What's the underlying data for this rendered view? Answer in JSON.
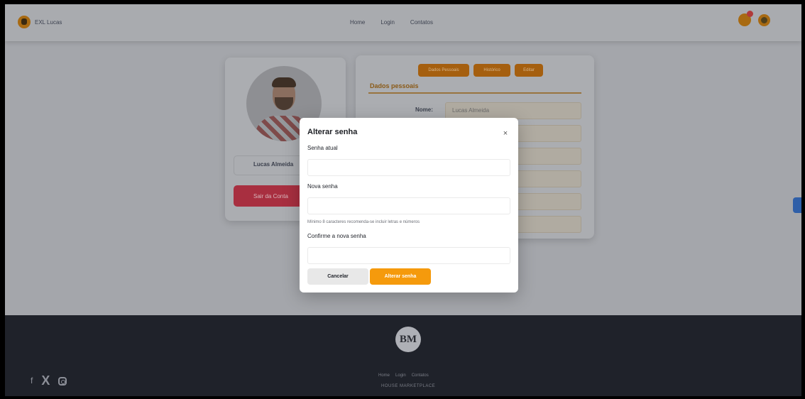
{
  "header": {
    "brand_name": "EXL Lucas",
    "nav": [
      "Home",
      "Login",
      "Contatos"
    ]
  },
  "profile": {
    "name": "Lucas Almeida",
    "exit_label": "Sair da Conta"
  },
  "data_card": {
    "tabs": [
      "Dados Pessoais",
      "Histórico",
      "Editar"
    ],
    "section_title": "Dados pessoais",
    "field_label": "Nome:",
    "field_value": "Lucas Almeida"
  },
  "footer": {
    "logo": "BM",
    "links": [
      "Home",
      "Login",
      "Contatos"
    ],
    "copyright": "HOUSE MARKETPLACE"
  },
  "modal": {
    "title": "Alterar senha",
    "close_icon": "×",
    "current_password_label": "Senha atual",
    "new_password_label": "Nova senha",
    "hint": "Mínimo 8 caracteres recomenda-se incluir letras e números",
    "confirm_password_label": "Confirme a nova senha",
    "current_password_value": "",
    "new_password_value": "",
    "confirm_password_value": "",
    "cancel_label": "Cancelar",
    "submit_label": "Alterar senha"
  },
  "colors": {
    "accent": "#f59a0c",
    "danger": "#a82f40",
    "footer_bg": "#1f222a"
  }
}
